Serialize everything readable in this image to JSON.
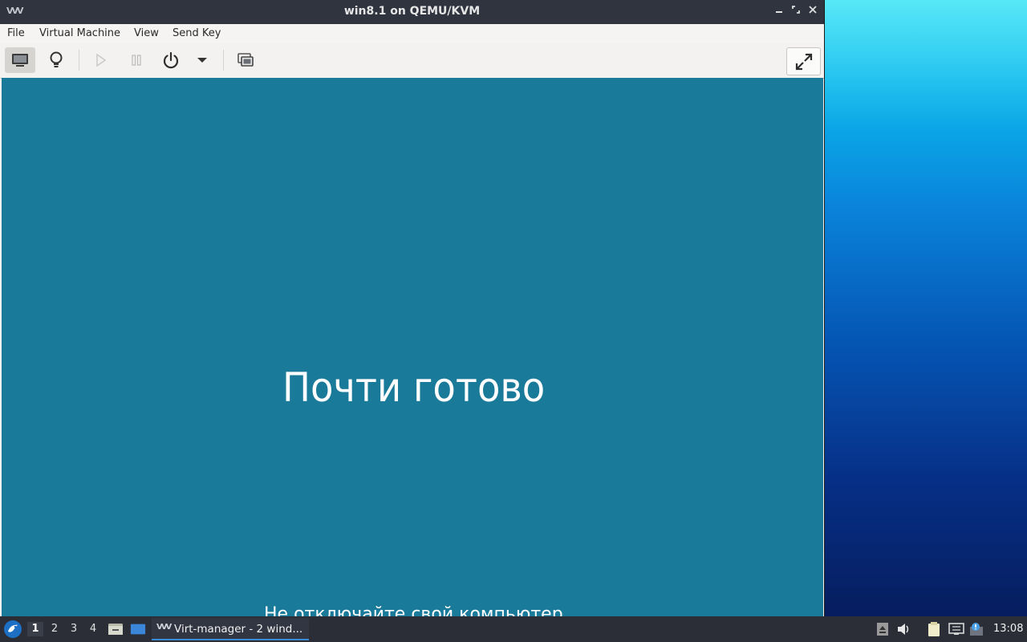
{
  "window": {
    "title": "win8.1 on QEMU/KVM",
    "app_icon_text": "VVV",
    "controls": {
      "minimize": "▬",
      "maximize": "⤢",
      "close": "✕"
    }
  },
  "menubar": {
    "items": [
      "File",
      "Virtual Machine",
      "View",
      "Send Key"
    ]
  },
  "toolbar": {
    "buttons": [
      "monitor-icon",
      "lightbulb-icon",
      "play-icon",
      "pause-icon",
      "power-icon",
      "dropdown-arrow-icon",
      "snapshots-icon",
      "fullscreen-icon"
    ]
  },
  "vm_screen": {
    "heading": "Почти готово",
    "subtitle": "Не отключайте свой компьютер",
    "background": "#1a7a9a"
  },
  "taskbar": {
    "workspaces": [
      "1",
      "2",
      "3",
      "4"
    ],
    "active_workspace": "1",
    "task_label": "Virt-manager - 2 wind...",
    "clock": "13:08",
    "tray_icons": [
      "eject-icon",
      "volume-icon",
      "clipboard-icon",
      "network-icon",
      "update-notifier-icon"
    ]
  }
}
